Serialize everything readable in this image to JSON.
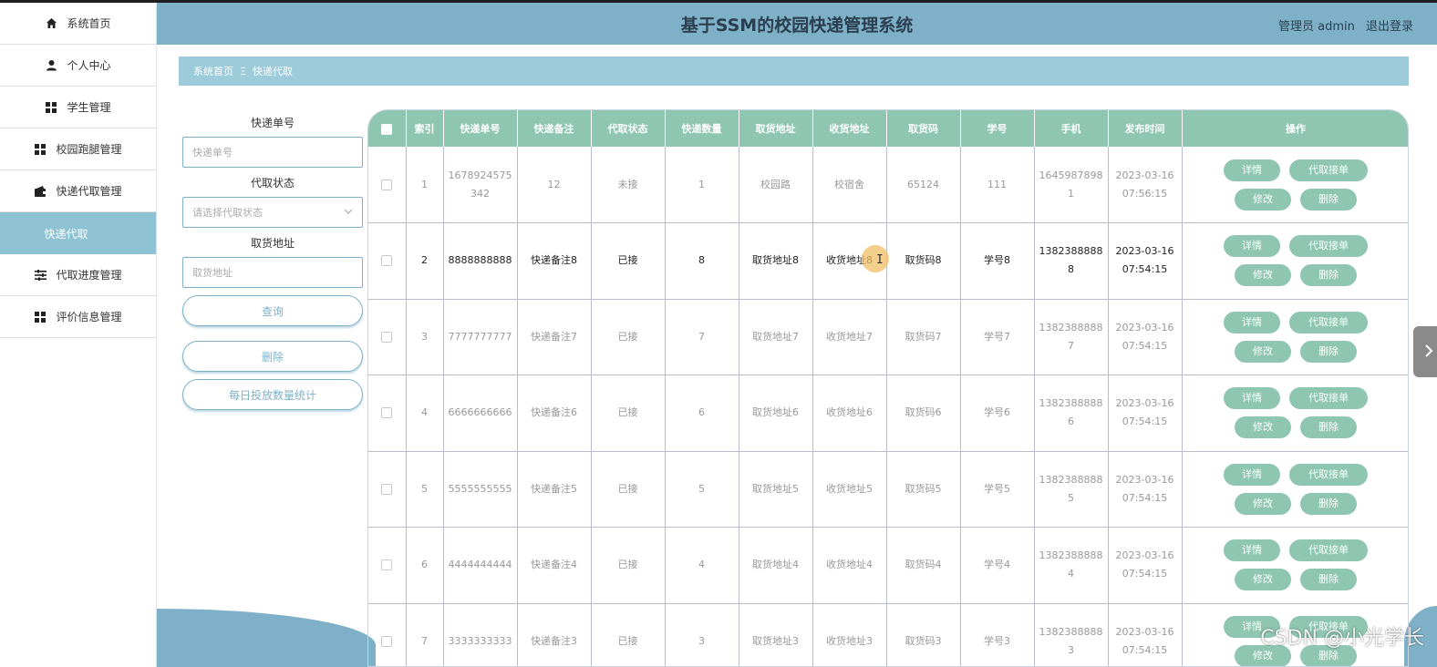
{
  "header": {
    "title": "基于SSM的校园快递管理系统",
    "user": "管理员 admin",
    "logout": "退出登录"
  },
  "sidebar": {
    "items": [
      {
        "label": "系统首页",
        "icon": "home-icon"
      },
      {
        "label": "个人中心",
        "icon": "user-icon"
      },
      {
        "label": "学生管理",
        "icon": "grid-icon"
      },
      {
        "label": "校园跑腿管理",
        "icon": "grid-icon"
      },
      {
        "label": "快递代取管理",
        "icon": "wallet-icon"
      },
      {
        "label": "快递代取",
        "icon": "",
        "active": true
      },
      {
        "label": "代取进度管理",
        "icon": "sliders-icon"
      },
      {
        "label": "评价信息管理",
        "icon": "grid-icon"
      }
    ]
  },
  "breadcrumb": {
    "home": "系统首页",
    "sep": "Ξ",
    "current": "快递代取"
  },
  "search": {
    "label_no": "快递单号",
    "placeholder_no": "快递单号",
    "label_status": "代取状态",
    "placeholder_status": "请选择代取状态",
    "label_addr": "取货地址",
    "placeholder_addr": "取货地址",
    "btn_query": "查询",
    "btn_delete": "删除",
    "btn_stats": "每日投放数量统计"
  },
  "table": {
    "headers": [
      "索引",
      "快递单号",
      "快递备注",
      "代取状态",
      "快递数量",
      "取货地址",
      "收货地址",
      "取货码",
      "学号",
      "手机",
      "发布时间",
      "操作"
    ],
    "rows": [
      [
        "1",
        "1678924575342",
        "12",
        "未接",
        "1",
        "校园路",
        "校宿舍",
        "65124",
        "111",
        "16459878981",
        "2023-03-16 07:56:15"
      ],
      [
        "2",
        "8888888888",
        "快递备注8",
        "已接",
        "8",
        "取货地址8",
        "收货地址8",
        "取货码8",
        "学号8",
        "13823888888",
        "2023-03-16 07:54:15"
      ],
      [
        "3",
        "7777777777",
        "快递备注7",
        "已接",
        "7",
        "取货地址7",
        "收货地址7",
        "取货码7",
        "学号7",
        "13823888887",
        "2023-03-16 07:54:15"
      ],
      [
        "4",
        "6666666666",
        "快递备注6",
        "已接",
        "6",
        "取货地址6",
        "收货地址6",
        "取货码6",
        "学号6",
        "13823888886",
        "2023-03-16 07:54:15"
      ],
      [
        "5",
        "5555555555",
        "快递备注5",
        "已接",
        "5",
        "取货地址5",
        "收货地址5",
        "取货码5",
        "学号5",
        "13823888885",
        "2023-03-16 07:54:15"
      ],
      [
        "6",
        "4444444444",
        "快递备注4",
        "已接",
        "4",
        "取货地址4",
        "收货地址4",
        "取货码4",
        "学号4",
        "13823888884",
        "2023-03-16 07:54:15"
      ],
      [
        "7",
        "3333333333",
        "快递备注3",
        "已接",
        "3",
        "取货地址3",
        "收货地址3",
        "取货码3",
        "学号3",
        "13823888883",
        "2023-03-16 07:54:15"
      ]
    ],
    "highlight_row": 1,
    "ops": {
      "detail": "详情",
      "accept": "代取接单",
      "edit": "修改",
      "delete": "删除"
    }
  },
  "watermark": "CSDN @小光学长",
  "colors": {
    "header": "#7eb1c8",
    "table_head": "#8ec6b2",
    "crumb": "#9dcbd9"
  }
}
